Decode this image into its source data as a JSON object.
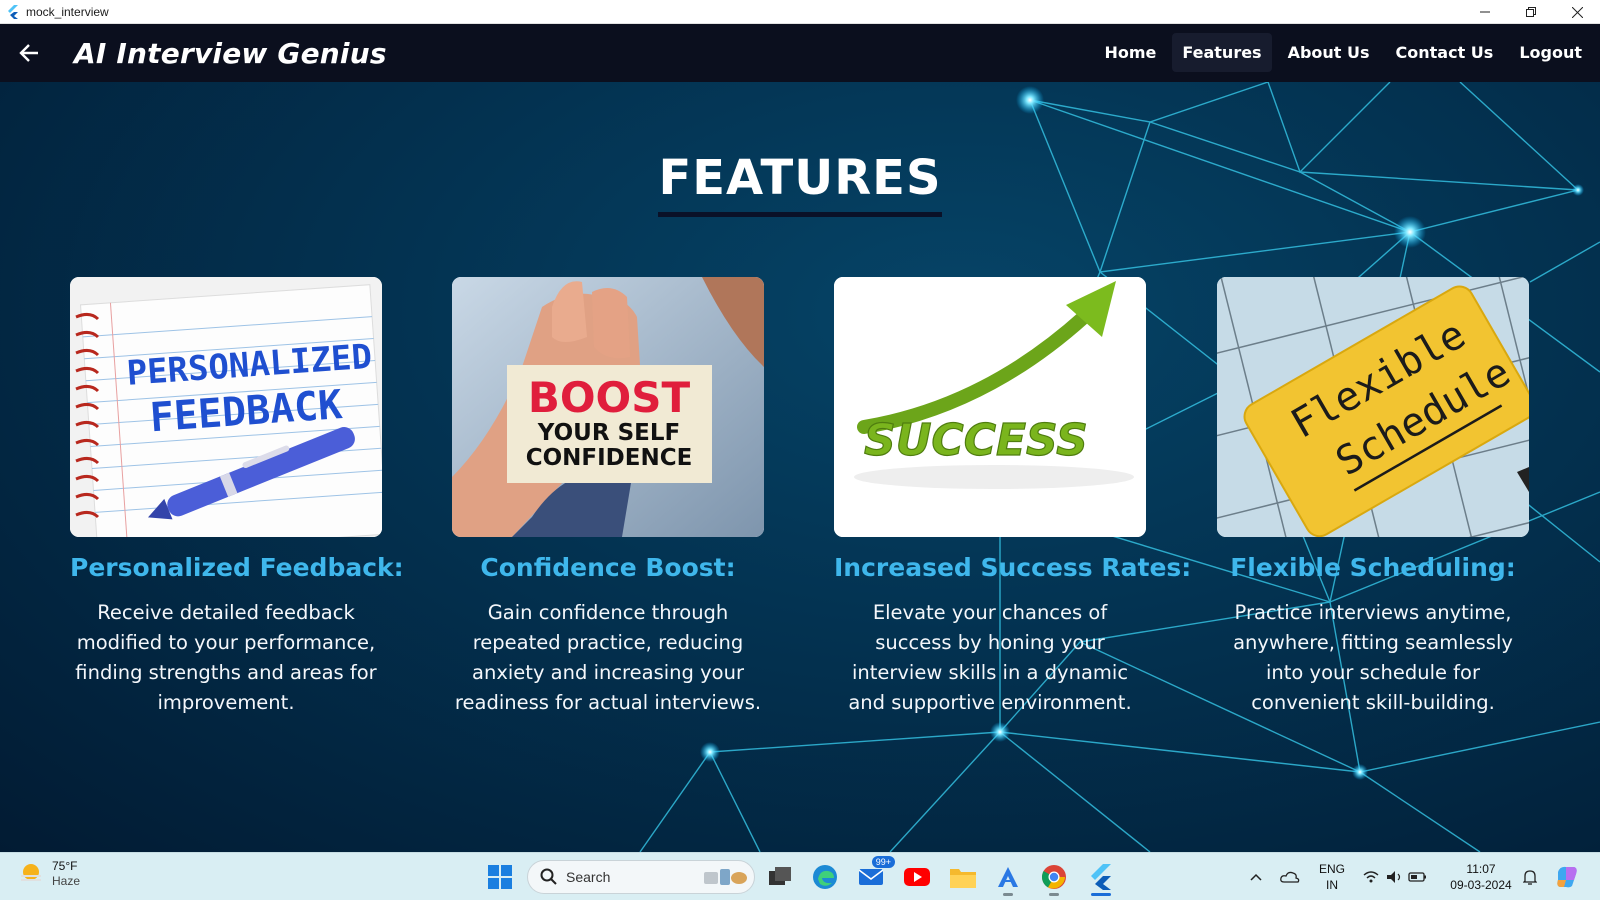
{
  "window": {
    "title": "mock_interview"
  },
  "appbar": {
    "brand": "AI Interview Genius",
    "nav": [
      {
        "label": "Home"
      },
      {
        "label": "Features",
        "active": true
      },
      {
        "label": "About Us"
      },
      {
        "label": "Contact Us"
      },
      {
        "label": "Logout"
      }
    ]
  },
  "page": {
    "heading": "FEATURES"
  },
  "cards": [
    {
      "title": "Personalized Feedback:",
      "description": "Receive detailed feedback modified to your performance, finding strengths and areas for improvement.",
      "image_text": [
        "PERSONALIZED",
        "FEEDBACK"
      ]
    },
    {
      "title": "Confidence Boost:",
      "description": "Gain confidence through repeated practice, reducing anxiety and increasing your readiness for actual interviews.",
      "image_text": [
        "BOOST",
        "YOUR SELF",
        "CONFIDENCE"
      ]
    },
    {
      "title": "Increased Success Rates:",
      "description": "Elevate your chances of success by honing your interview skills in a dynamic and supportive environment.",
      "image_text": [
        "SUCCESS"
      ]
    },
    {
      "title": "Flexible Scheduling:",
      "description": "Practice interviews anytime, anywhere, fitting seamlessly into your schedule for convenient skill-building.",
      "image_text": [
        "Flexible",
        "Schedule"
      ]
    }
  ],
  "taskbar": {
    "weather": {
      "temp": "75°F",
      "condition": "Haze"
    },
    "search_label": "Search",
    "mail_badge": "99+",
    "language": {
      "line1": "ENG",
      "line2": "IN"
    },
    "clock": {
      "time": "11:07",
      "date": "09-03-2024"
    }
  },
  "colors": {
    "appbar_bg": "#0b0f1e",
    "card_title": "#3fb7ec",
    "page_bg": "#02263f"
  }
}
